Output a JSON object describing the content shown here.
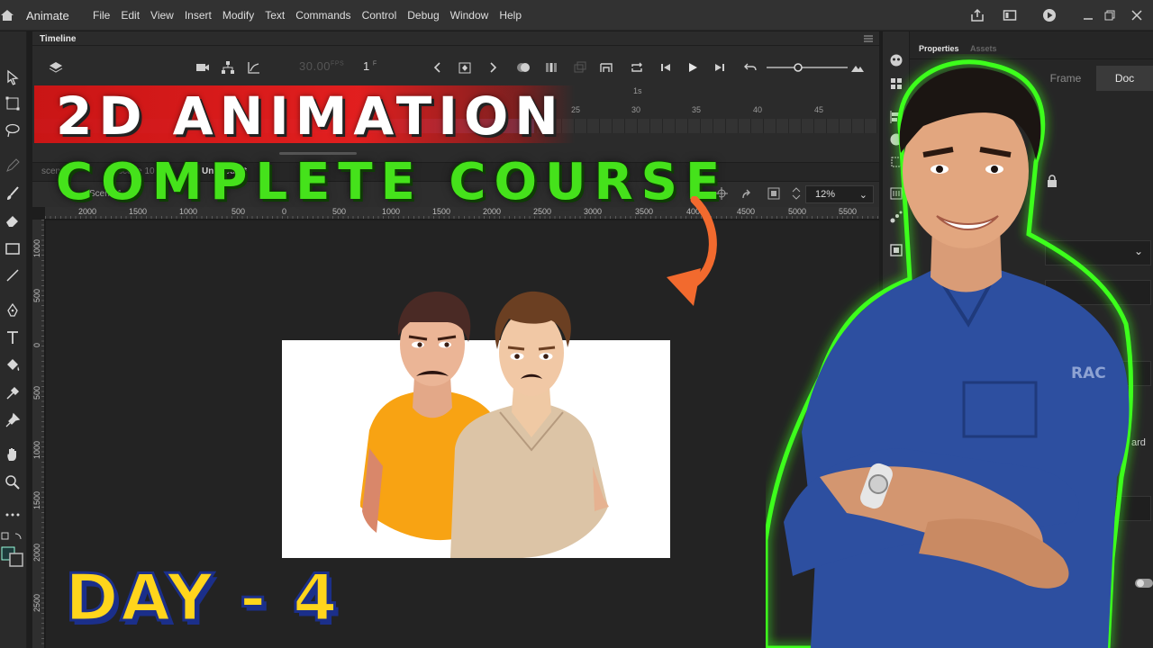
{
  "menubar": {
    "app_name": "Animate",
    "items": [
      "File",
      "Edit",
      "View",
      "Insert",
      "Modify",
      "Text",
      "Commands",
      "Control",
      "Debug",
      "Window",
      "Help"
    ]
  },
  "timeline": {
    "tab_label": "Timeline",
    "fps_value": "30.00",
    "fps_unit": "FPS",
    "frame_value": "1",
    "frame_unit": "F",
    "seconds_marker": "1s",
    "frame_numbers": [
      "25",
      "30",
      "35",
      "40",
      "45"
    ]
  },
  "scenes": {
    "tabs": [
      "scene1",
      "scene 10",
      "Untitled-1*"
    ],
    "current_scene": "Scene 1"
  },
  "stage": {
    "zoom": "12%",
    "h_ruler": [
      "2000",
      "1500",
      "1000",
      "500",
      "0",
      "500",
      "1000",
      "1500",
      "2000",
      "2500",
      "3000",
      "3500",
      "4000",
      "4500",
      "5000",
      "5500"
    ],
    "v_ruler": [
      "1000",
      "500",
      "0",
      "500",
      "1000",
      "1500",
      "2000",
      "2500"
    ]
  },
  "properties": {
    "tabs": [
      "Properties",
      "Assets"
    ],
    "segments": [
      "Frame",
      "Doc"
    ],
    "partial_text": "ard"
  },
  "overlay": {
    "title_line1": "2D ANIMATION",
    "title_line2": "COMPLETE COURSE",
    "day_label": "DAY - 4",
    "shirt_text": "RAC"
  },
  "colors": {
    "title_band": "#e01f1f",
    "title_green": "#45e21b",
    "day_yellow": "#ffd51c",
    "arrow_orange": "#f26a2e",
    "glow_green": "#3cff1a"
  }
}
